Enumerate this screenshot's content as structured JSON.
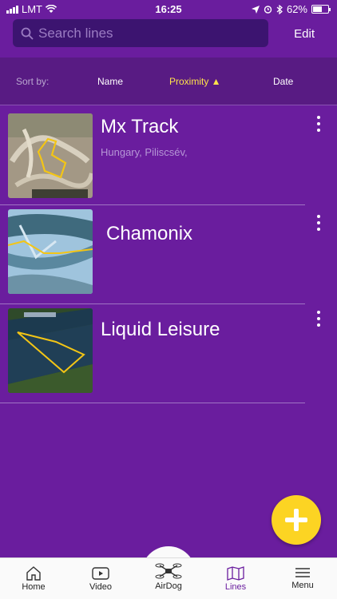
{
  "status_bar": {
    "carrier": "LMT",
    "time": "16:25",
    "battery": "62%",
    "battery_level": 0.62
  },
  "header": {
    "search_placeholder": "Search lines",
    "edit_label": "Edit"
  },
  "sort": {
    "label": "Sort by:",
    "options": [
      "Name",
      "Proximity ▲",
      "Date"
    ],
    "active": "Proximity"
  },
  "lines": [
    {
      "name": "Mx Track",
      "location": "Hungary, Piliscsév,"
    },
    {
      "name": "Chamonix",
      "location": ""
    },
    {
      "name": "Liquid Leisure",
      "location": ""
    }
  ],
  "tabs": [
    "Home",
    "Video",
    "AirDog",
    "Lines",
    "Menu"
  ],
  "active_tab": "Lines",
  "colors": {
    "background": "#6a1d9e",
    "sort_bar": "#581b83",
    "accent": "#ffe24a",
    "fab": "#fcd423"
  }
}
